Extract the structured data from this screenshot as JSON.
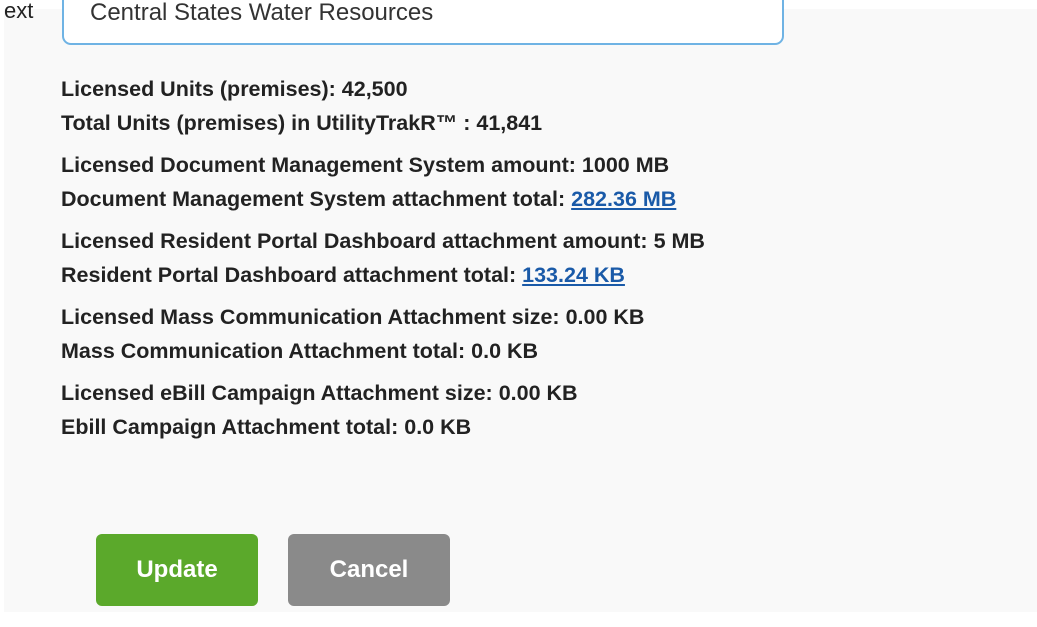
{
  "top_field": {
    "label": "ext",
    "value": "Central States Water Resources"
  },
  "info": [
    [
      {
        "label": "Licensed Units (premises):",
        "value": "42,500"
      },
      {
        "label": "Total Units (premises) in UtilityTrakR™ :",
        "value": "41,841"
      }
    ],
    [
      {
        "label": "Licensed Document Management System amount:",
        "value": "1000 MB"
      },
      {
        "label": "Document Management System attachment total:",
        "value": "282.36 MB",
        "link": true
      }
    ],
    [
      {
        "label": "Licensed Resident Portal Dashboard attachment amount:",
        "value": "5 MB"
      },
      {
        "label": "Resident Portal Dashboard attachment total:",
        "value": "133.24 KB",
        "link": true
      }
    ],
    [
      {
        "label": "Licensed Mass Communication Attachment size:",
        "value": "0.00 KB"
      },
      {
        "label": "Mass Communication Attachment total:",
        "value": "0.0 KB"
      }
    ],
    [
      {
        "label": "Licensed eBill Campaign Attachment size:",
        "value": "0.00 KB"
      },
      {
        "label": "Ebill Campaign Attachment total:",
        "value": "0.0 KB"
      }
    ]
  ],
  "buttons": {
    "update": "Update",
    "cancel": "Cancel"
  },
  "colors": {
    "update_bg": "#5ba92b",
    "cancel_bg": "#8a8a8a",
    "link": "#1a5aa8",
    "field_border": "#6fb3e4"
  }
}
